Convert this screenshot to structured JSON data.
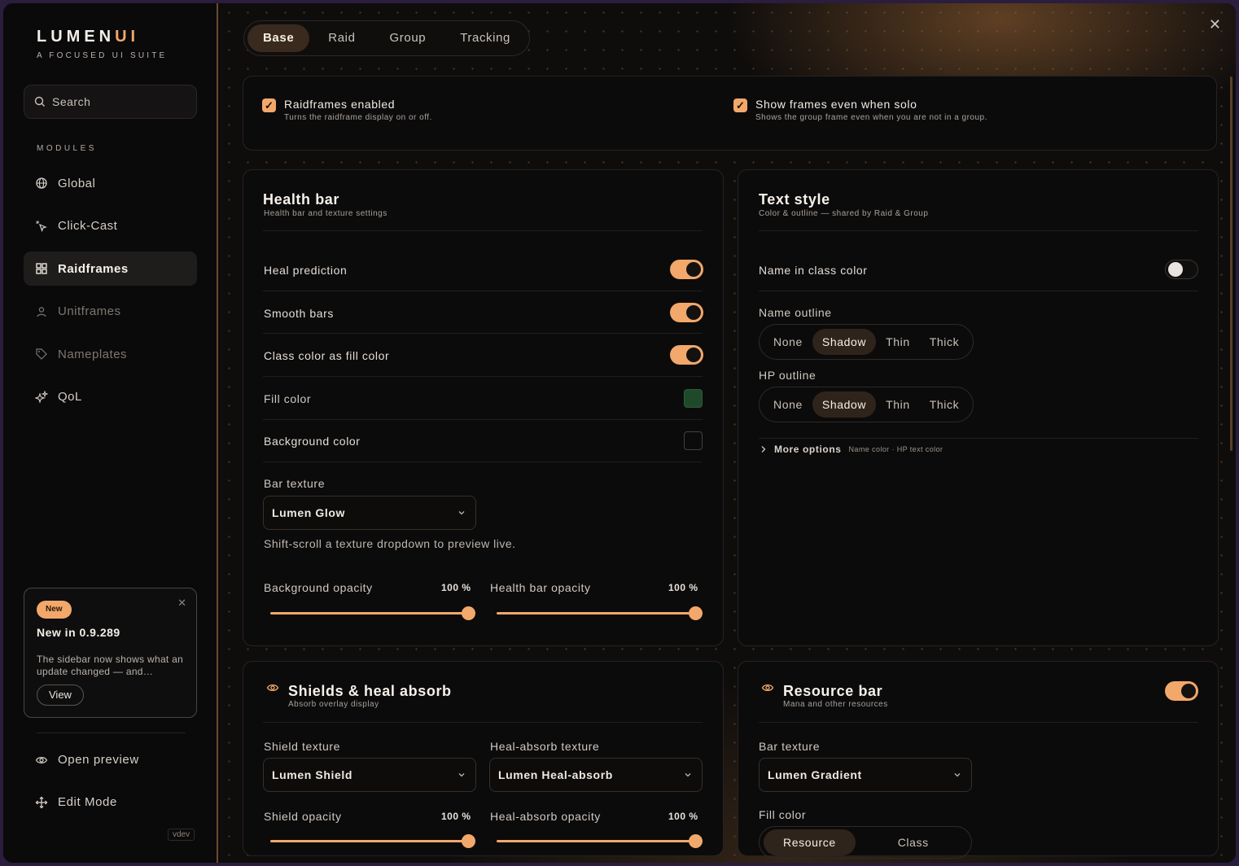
{
  "app": {
    "brand_main": "LUMEN",
    "brand_accent": "UI",
    "tagline": "A FOCUSED UI SUITE"
  },
  "sidebar": {
    "search_placeholder": "Search",
    "modules_label": "MODULES",
    "items": [
      {
        "label": "Global",
        "icon": "globe-icon"
      },
      {
        "label": "Click-Cast",
        "icon": "sparkle-cursor-icon"
      },
      {
        "label": "Raidframes",
        "icon": "grid-icon",
        "active": true
      },
      {
        "label": "Unitframes",
        "icon": "user-icon"
      },
      {
        "label": "Nameplates",
        "icon": "tag-icon"
      },
      {
        "label": "QoL",
        "icon": "stars-icon"
      }
    ],
    "news": {
      "badge": "New",
      "title": "New in 0.9.289",
      "body": "The sidebar now shows what an update changed — and…",
      "view_label": "View"
    },
    "open_preview": "Open preview",
    "edit_mode": "Edit Mode",
    "version": "vdev"
  },
  "tabs": [
    "Base",
    "Raid",
    "Group",
    "Tracking"
  ],
  "active_tab": "Base",
  "general": {
    "raidframes_enabled": {
      "label": "Raidframes enabled",
      "sub": "Turns the raidframe display on or off.",
      "checked": true
    },
    "show_solo": {
      "label": "Show frames even when solo",
      "sub": "Shows the group frame even when you are not in a group.",
      "checked": true
    }
  },
  "health_bar": {
    "title": "Health bar",
    "sub": "Health bar and texture settings",
    "heal_prediction": "Heal prediction",
    "smooth_bars": "Smooth bars",
    "class_color_fill": "Class color as fill color",
    "fill_color": "Fill color",
    "fill_color_value": "#1f4a2a",
    "background_color": "Background color",
    "background_color_value": "#0c0b0b",
    "bar_texture_label": "Bar texture",
    "bar_texture_value": "Lumen Glow",
    "hint": "Shift-scroll a texture dropdown to preview live.",
    "bg_opacity_label": "Background opacity",
    "bg_opacity_value": "100 %",
    "hb_opacity_label": "Health bar opacity",
    "hb_opacity_value": "100 %"
  },
  "text_style": {
    "title": "Text style",
    "sub": "Color & outline — shared by Raid & Group",
    "name_class_color": "Name in class color",
    "name_outline_label": "Name outline",
    "hp_outline_label": "HP outline",
    "outline_options": [
      "None",
      "Shadow",
      "Thin",
      "Thick"
    ],
    "name_outline_selected": "Shadow",
    "hp_outline_selected": "Shadow",
    "more_options": "More options",
    "more_options_sub": "Name color · HP text color"
  },
  "shields": {
    "title": "Shields & heal absorb",
    "sub": "Absorb overlay display",
    "shield_texture_label": "Shield texture",
    "shield_texture_value": "Lumen Shield",
    "heal_absorb_texture_label": "Heal-absorb texture",
    "heal_absorb_texture_value": "Lumen Heal-absorb",
    "shield_opacity_label": "Shield opacity",
    "shield_opacity_value": "100 %",
    "heal_absorb_opacity_label": "Heal-absorb opacity",
    "heal_absorb_opacity_value": "100 %"
  },
  "resource_bar": {
    "title": "Resource bar",
    "sub": "Mana and other resources",
    "bar_texture_label": "Bar texture",
    "bar_texture_value": "Lumen Gradient",
    "fill_color_label": "Fill color",
    "fill_options": [
      "Resource",
      "Class"
    ]
  },
  "colors": {
    "accent": "#f2a86a",
    "background": "#0c0b0b",
    "border": "#6a4a2e"
  }
}
